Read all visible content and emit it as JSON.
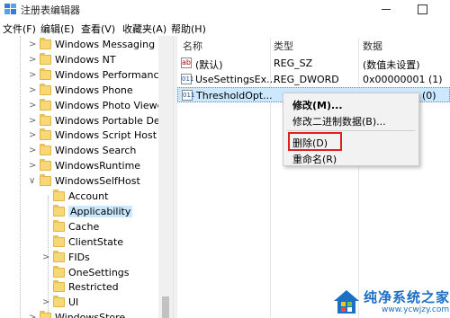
{
  "window": {
    "title": "注册表编辑器",
    "icon": "registry-icon"
  },
  "menu": [
    "文件(F)",
    "编辑(E)",
    "查看(V)",
    "收藏夹(A)",
    "帮助(H)"
  ],
  "tree": {
    "items": [
      {
        "label": "Windows Messaging Su",
        "arrow": ">"
      },
      {
        "label": "Windows NT",
        "arrow": ">"
      },
      {
        "label": "Windows Performance",
        "arrow": ">"
      },
      {
        "label": "Windows Phone",
        "arrow": ">"
      },
      {
        "label": "Windows Photo Viewer",
        "arrow": ">"
      },
      {
        "label": "Windows Portable Devi",
        "arrow": ">"
      },
      {
        "label": "Windows Script Host",
        "arrow": ">"
      },
      {
        "label": "Windows Search",
        "arrow": ">"
      },
      {
        "label": "WindowsRuntime",
        "arrow": ">"
      },
      {
        "label": "WindowsSelfHost",
        "arrow": "v"
      },
      {
        "label": "Account",
        "arrow": ""
      },
      {
        "label": "Applicability",
        "arrow": "",
        "selected": true
      },
      {
        "label": "Cache",
        "arrow": ""
      },
      {
        "label": "ClientState",
        "arrow": ""
      },
      {
        "label": "FIDs",
        "arrow": ">"
      },
      {
        "label": "OneSettings",
        "arrow": ""
      },
      {
        "label": "Restricted",
        "arrow": ""
      },
      {
        "label": "UI",
        "arrow": ">"
      },
      {
        "label": "WindowsStore",
        "arrow": ">"
      }
    ]
  },
  "list": {
    "headers": {
      "name": "名称",
      "type": "类型",
      "data": "数据"
    },
    "rows": [
      {
        "icon": "string-value-icon",
        "icon_glyph": "ab",
        "name": "(默认)",
        "type": "REG_SZ",
        "data": "(数值未设置)"
      },
      {
        "icon": "binary-value-icon",
        "icon_glyph": "011",
        "name": "UseSettingsEx...",
        "type": "REG_DWORD",
        "data": "0x00000001 (1)"
      },
      {
        "icon": "binary-value-icon",
        "icon_glyph": "011",
        "name": "ThresholdOpt...",
        "type": "",
        "data": "(0)",
        "selected": true
      }
    ]
  },
  "context_menu": {
    "items": [
      "修改(M)...",
      "修改二进制数据(B)...",
      "删除(D)",
      "重命名(R)"
    ],
    "highlighted": "删除(D)",
    "highlight_color": "#e02020"
  },
  "watermark": {
    "brand": "纯净系统之家",
    "url": "www.ycwjzy.com"
  },
  "colors": {
    "selection": "#cce8ff",
    "folder": "#f8d775",
    "brand_blue": "#1b6fc4"
  }
}
